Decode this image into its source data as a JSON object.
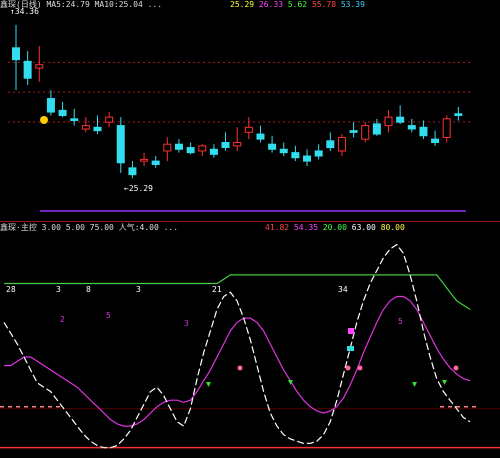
{
  "colors": {
    "up": "#ff3030",
    "down": "#33ddee",
    "fast_line": "#ffffff",
    "slow_line": "#dd33dd",
    "upper_band": "#44cc44",
    "level_line": "#ff3030",
    "dashed_level": "#ff8080",
    "purple_line": "#9933ff"
  },
  "price_panel": {
    "header": "鑫琛(日线)  MA5:24.79  MA10:25.04  ...",
    "header_values": [
      "25.29",
      "26.33",
      "5.62",
      "55.78",
      "53.39"
    ],
    "high_price_label": "34.36",
    "low_price_label": "25.29",
    "candles": [
      {
        "o": 33.0,
        "h": 34.36,
        "l": 30.5,
        "c": 32.3,
        "up": false
      },
      {
        "o": 32.2,
        "h": 32.8,
        "l": 30.8,
        "c": 31.2,
        "up": false
      },
      {
        "o": 31.8,
        "h": 33.1,
        "l": 31.0,
        "c": 32.0,
        "up": true
      },
      {
        "o": 30.0,
        "h": 30.5,
        "l": 29.0,
        "c": 29.2,
        "up": false
      },
      {
        "o": 29.3,
        "h": 29.8,
        "l": 28.9,
        "c": 29.0,
        "up": false
      },
      {
        "o": 28.8,
        "h": 29.4,
        "l": 28.4,
        "c": 28.7,
        "up": false
      },
      {
        "o": 28.4,
        "h": 28.9,
        "l": 28.0,
        "c": 28.2,
        "up": true
      },
      {
        "o": 28.3,
        "h": 29.0,
        "l": 27.9,
        "c": 28.1,
        "up": false
      },
      {
        "o": 28.6,
        "h": 29.2,
        "l": 28.3,
        "c": 28.9,
        "up": true
      },
      {
        "o": 28.4,
        "h": 28.9,
        "l": 25.6,
        "c": 26.2,
        "up": false
      },
      {
        "o": 25.9,
        "h": 26.3,
        "l": 25.29,
        "c": 25.5,
        "up": false
      },
      {
        "o": 26.4,
        "h": 26.8,
        "l": 26.0,
        "c": 26.3,
        "up": true
      },
      {
        "o": 26.3,
        "h": 26.6,
        "l": 25.9,
        "c": 26.1,
        "up": false
      },
      {
        "o": 26.9,
        "h": 27.7,
        "l": 26.3,
        "c": 27.3,
        "up": true
      },
      {
        "o": 27.3,
        "h": 27.6,
        "l": 26.8,
        "c": 27.0,
        "up": false
      },
      {
        "o": 27.1,
        "h": 27.4,
        "l": 26.7,
        "c": 26.8,
        "up": false
      },
      {
        "o": 26.9,
        "h": 27.3,
        "l": 26.6,
        "c": 27.2,
        "up": true
      },
      {
        "o": 27.0,
        "h": 27.3,
        "l": 26.5,
        "c": 26.7,
        "up": false
      },
      {
        "o": 27.4,
        "h": 28.0,
        "l": 26.9,
        "c": 27.1,
        "up": false
      },
      {
        "o": 27.4,
        "h": 28.3,
        "l": 26.9,
        "c": 27.2,
        "up": true
      },
      {
        "o": 28.3,
        "h": 28.9,
        "l": 27.6,
        "c": 28.0,
        "up": true
      },
      {
        "o": 27.9,
        "h": 28.4,
        "l": 27.4,
        "c": 27.6,
        "up": false
      },
      {
        "o": 27.3,
        "h": 27.8,
        "l": 26.8,
        "c": 27.0,
        "up": false
      },
      {
        "o": 27.0,
        "h": 27.4,
        "l": 26.6,
        "c": 26.8,
        "up": false
      },
      {
        "o": 26.8,
        "h": 27.2,
        "l": 26.3,
        "c": 26.5,
        "up": false
      },
      {
        "o": 26.6,
        "h": 27.0,
        "l": 26.0,
        "c": 26.3,
        "up": false
      },
      {
        "o": 26.9,
        "h": 27.3,
        "l": 26.4,
        "c": 26.6,
        "up": false
      },
      {
        "o": 27.5,
        "h": 28.0,
        "l": 26.9,
        "c": 27.1,
        "up": false
      },
      {
        "o": 26.9,
        "h": 27.9,
        "l": 26.6,
        "c": 27.7,
        "up": true
      },
      {
        "o": 28.1,
        "h": 28.6,
        "l": 27.7,
        "c": 28.0,
        "up": false
      },
      {
        "o": 27.6,
        "h": 28.6,
        "l": 27.4,
        "c": 28.4,
        "up": true
      },
      {
        "o": 28.5,
        "h": 28.8,
        "l": 27.8,
        "c": 27.9,
        "up": false
      },
      {
        "o": 28.4,
        "h": 29.3,
        "l": 28.0,
        "c": 28.9,
        "up": true
      },
      {
        "o": 28.9,
        "h": 29.6,
        "l": 28.5,
        "c": 28.6,
        "up": false
      },
      {
        "o": 28.4,
        "h": 28.8,
        "l": 28.0,
        "c": 28.2,
        "up": false
      },
      {
        "o": 28.3,
        "h": 28.7,
        "l": 27.6,
        "c": 27.8,
        "up": false
      },
      {
        "o": 27.6,
        "h": 28.1,
        "l": 27.2,
        "c": 27.4,
        "up": false
      },
      {
        "o": 27.7,
        "h": 29.0,
        "l": 27.4,
        "c": 28.8,
        "up": true
      },
      {
        "o": 29.0,
        "h": 29.5,
        "l": 28.7,
        "c": 29.1,
        "up": false
      }
    ]
  },
  "indicator_panel": {
    "header": "鑫琛·主控  3.00  5.00  75.00  人气:4.00  ...",
    "header_values": [
      "41.82",
      "54.35",
      "20.00",
      "63.00",
      "80.00"
    ],
    "text_marks": [
      {
        "text": "28",
        "color": "#ffffff"
      },
      {
        "text": "3",
        "color": "#ffffff"
      },
      {
        "text": "8",
        "color": "#ffffff"
      },
      {
        "text": "3",
        "color": "#ffffff"
      },
      {
        "text": "21",
        "color": "#ffffff"
      },
      {
        "text": "34",
        "color": "#ffffff"
      },
      {
        "text": "2",
        "color": "#dd33dd"
      },
      {
        "text": "5",
        "color": "#dd33dd"
      },
      {
        "text": "3",
        "color": "#dd33dd"
      },
      {
        "text": "5",
        "color": "#dd33dd"
      }
    ],
    "fast": [
      60,
      55,
      50,
      44,
      38,
      32,
      30,
      28,
      24,
      20,
      16,
      12,
      8,
      5,
      3,
      2,
      2,
      3,
      6,
      10,
      16,
      22,
      28,
      30,
      26,
      20,
      14,
      12,
      20,
      34,
      46,
      56,
      66,
      72,
      74,
      70,
      62,
      52,
      40,
      28,
      18,
      12,
      8,
      6,
      5,
      4,
      4,
      5,
      8,
      14,
      24,
      36,
      48,
      60,
      70,
      78,
      84,
      90,
      94,
      96,
      92,
      82,
      70,
      56,
      44,
      34,
      28,
      24,
      20,
      16,
      14
    ],
    "slow": [
      40,
      40,
      42,
      44,
      44,
      42,
      40,
      38,
      36,
      34,
      32,
      30,
      27,
      24,
      21,
      18,
      15,
      13,
      12,
      12,
      13,
      15,
      18,
      21,
      23,
      24,
      24,
      23,
      24,
      28,
      33,
      38,
      44,
      50,
      56,
      60,
      62,
      62,
      60,
      56,
      50,
      44,
      38,
      33,
      28,
      24,
      21,
      19,
      18,
      19,
      21,
      25,
      31,
      38,
      46,
      53,
      60,
      66,
      70,
      72,
      72,
      70,
      66,
      60,
      54,
      48,
      43,
      39,
      36,
      34,
      33
    ],
    "band": [
      78,
      78,
      78,
      78,
      78,
      78,
      78,
      78,
      78,
      78,
      78,
      78,
      78,
      78,
      78,
      78,
      78,
      78,
      78,
      78,
      78,
      78,
      78,
      78,
      78,
      78,
      78,
      78,
      78,
      78,
      78,
      78,
      78,
      80,
      82,
      82,
      82,
      82,
      82,
      82,
      82,
      82,
      82,
      82,
      82,
      82,
      82,
      82,
      82,
      82,
      82,
      82,
      82,
      82,
      82,
      82,
      82,
      82,
      82,
      82,
      82,
      82,
      82,
      82,
      82,
      82,
      78,
      74,
      70,
      68,
      66
    ],
    "dashed_level": 20,
    "bottom_level": 2
  }
}
